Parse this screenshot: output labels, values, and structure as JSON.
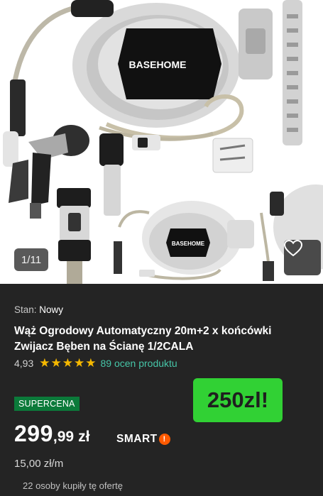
{
  "gallery": {
    "counter": "1/11",
    "brand_logo": "BASEHOME",
    "brand_logo_small": "BASEHOME",
    "favorite_icon": "heart-icon"
  },
  "product": {
    "condition_label": "Stan:",
    "condition_value": "Nowy",
    "title": "Wąż Ogrodowy Automatyczny 20m+2 x końcówki Zwijacz Bęben na Ścianę 1/2CALA",
    "rating": "4,93",
    "stars": 5,
    "reviews": "89 ocen produktu",
    "badge": "SUPERCENA",
    "promo_label": "250zl!",
    "price_int": "299",
    "price_dec": ",99",
    "currency": "zł",
    "smart_label": "SMART",
    "smart_badge": "!",
    "unit_price": "15,00 zł/m",
    "bought": "22 osoby kupiły tę ofertę"
  },
  "colors": {
    "background": "#242424",
    "promo": "#31d134",
    "badge": "#0b7a3a",
    "stars": "#f5b800",
    "link": "#46c6a8",
    "smart": "#ff5a00"
  }
}
